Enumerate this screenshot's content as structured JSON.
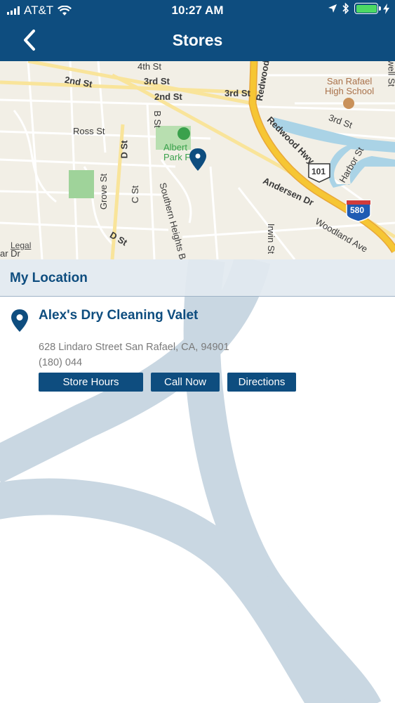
{
  "status_bar": {
    "carrier": "AT&T",
    "time": "10:27 AM",
    "signal_icon": "signal-bars-icon",
    "wifi_icon": "wifi-icon",
    "location_icon": "location-arrow-icon",
    "bluetooth_icon": "bluetooth-icon",
    "battery_icon": "battery-icon",
    "charging_icon": "charging-bolt-icon"
  },
  "nav": {
    "title": "Stores",
    "back_icon": "chevron-left-icon"
  },
  "map": {
    "labels": {
      "fourth_st": "4th St",
      "second_st_left": "2nd St",
      "third_st_top": "3rd St",
      "second_st_mid": "2nd St",
      "third_st_mid": "3rd St",
      "redwood_top": "Redwood",
      "san_rafael_hs": "San Rafael\nHigh School",
      "third_st_right": "3rd St",
      "ross_st": "Ross St",
      "b_st": "B St",
      "albert_park": "Albert\nPark F",
      "redwood_hwy": "Redwood Hwy",
      "d_st_vertical": "D St",
      "hwy_101": "101",
      "harbor_st": "Harbor St",
      "grove_st": "Grove St",
      "c_st": "C St",
      "southern_heights": "Southern Heights B",
      "andersen_dr": "Andersen Dr",
      "hwy_580": "580",
      "d_st_bottom": "D St",
      "irwin_st": "Irwin St",
      "woodland_ave": "Woodland Ave",
      "ewell_st": "ewell St",
      "ar_dr": "ar Dr"
    },
    "legal": "Legal",
    "colors": {
      "land": "#f2efe6",
      "highway": "#f6c634",
      "water": "#aad3e6",
      "park": "#9fd39a",
      "pin": "#0e4d7f"
    }
  },
  "section": {
    "title": "My Location"
  },
  "store": {
    "name": "Alex's Dry Cleaning Valet",
    "address": "628 Lindaro Street San Rafael, CA, 94901",
    "phone": "(180) 044",
    "pin_icon": "map-pin-icon",
    "buttons": {
      "hours": "Store Hours",
      "call": "Call Now",
      "directions": "Directions"
    }
  },
  "colors": {
    "primary": "#0e4d7f",
    "section_bg": "#e2e9f0",
    "decoration": "#c9d7e2"
  }
}
